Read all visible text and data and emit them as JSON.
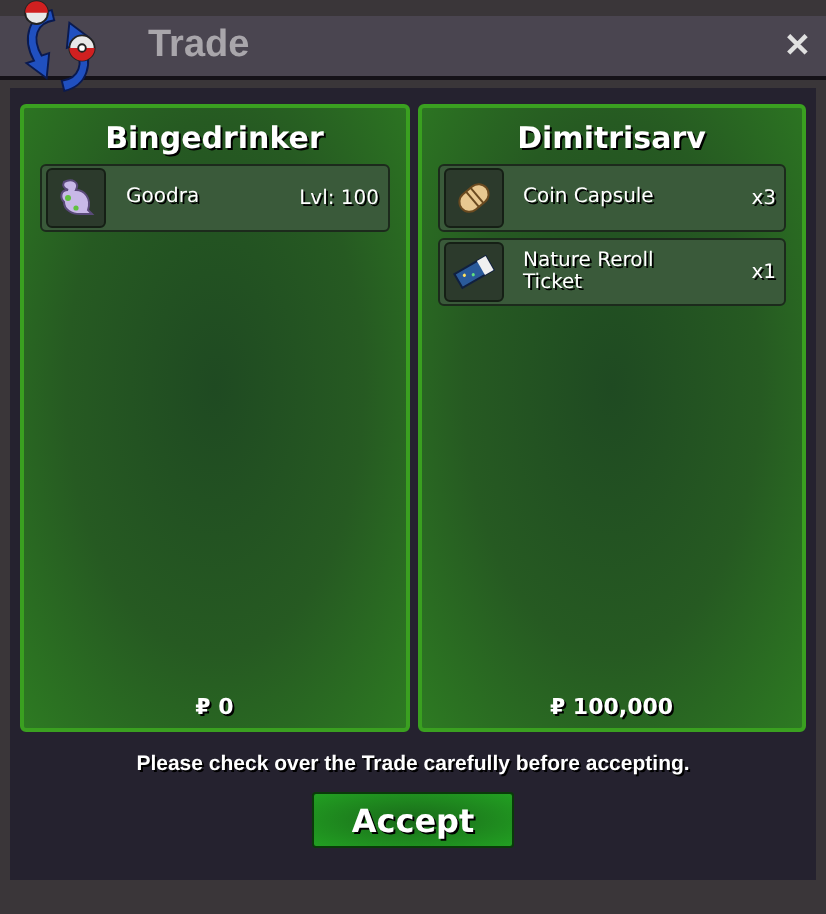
{
  "window": {
    "title": "Trade",
    "close": "✕"
  },
  "panels": [
    {
      "trainer": "Bingedrinker",
      "items": [
        {
          "kind": "pokemon",
          "name": "Goodra",
          "detail": "Lvl: 100"
        }
      ],
      "money": "₽ 0"
    },
    {
      "trainer": "Dimitrisarv",
      "items": [
        {
          "kind": "capsule",
          "name": "Coin Capsule",
          "detail": "x3"
        },
        {
          "kind": "ticket",
          "name": "Nature Reroll Ticket",
          "detail": "x1"
        }
      ],
      "money": "₽ 100,000"
    }
  ],
  "message": "Please check over the Trade carefully before accepting.",
  "accept_button": "Accept"
}
